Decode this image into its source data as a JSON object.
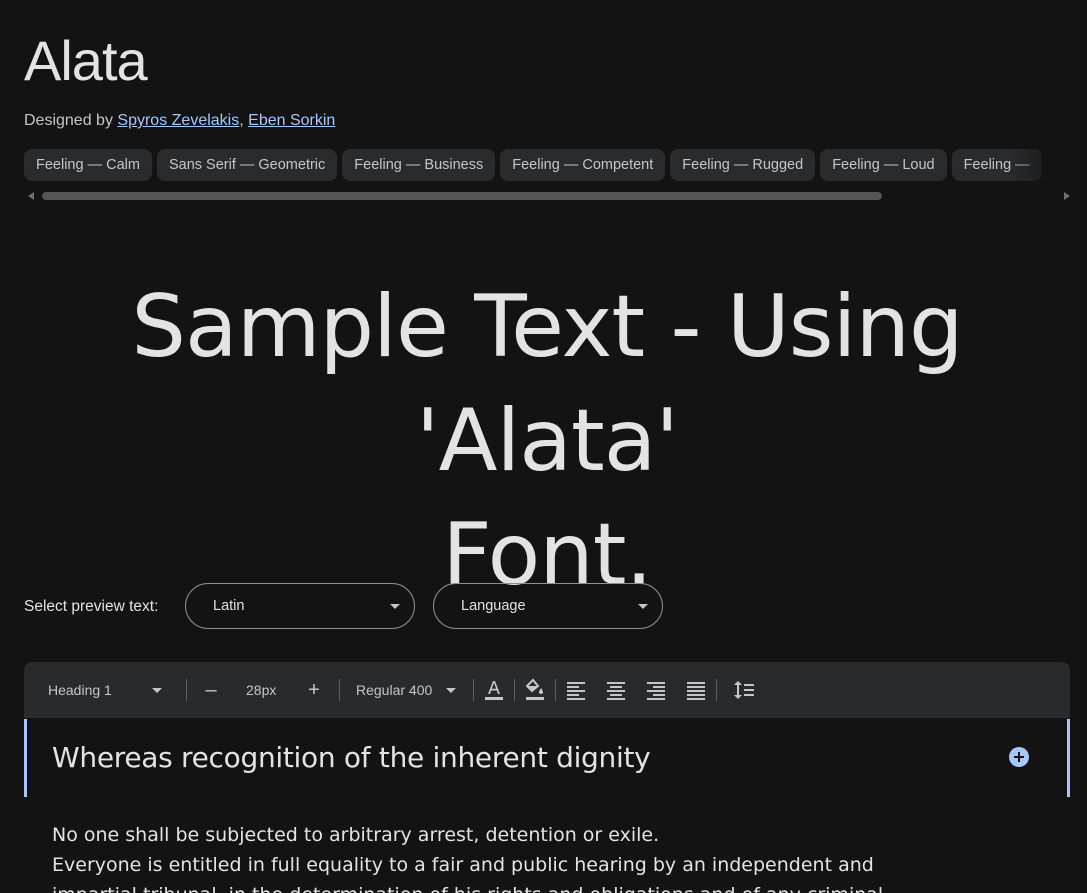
{
  "font": {
    "name": "Alata",
    "designed_by_label": "Designed by",
    "designers": [
      "Spyros Zevelakis",
      "Eben Sorkin"
    ],
    "designer_separator": ","
  },
  "tags": [
    "Feeling — Calm",
    "Sans Serif — Geometric",
    "Feeling — Business",
    "Feeling — Competent",
    "Feeling — Rugged",
    "Feeling — Loud",
    "Feeling —"
  ],
  "sample": {
    "line1": "Sample Text - Using 'Alata'",
    "line2": "Font."
  },
  "preview": {
    "label": "Select preview text:",
    "script_value": "Latin",
    "language_value": "Language"
  },
  "toolbar": {
    "style_value": "Heading 1",
    "decrease_label": "–",
    "size_value": "28px",
    "increase_label": "+",
    "weight_value": "Regular 400"
  },
  "editor": {
    "heading": "Whereas recognition of the inherent dignity",
    "body_lines": [
      "No one shall be subjected to arbitrary arrest, detention or exile.",
      "Everyone is entitled in full equality to a fair and public hearing by an independent and",
      "impartial tribunal, in the determination of his rights and obligations and of any criminal"
    ]
  },
  "colors": {
    "background": "#131314",
    "accent": "#a8c7fa",
    "chip": "#2a2b2d",
    "toolbar": "#282a2c"
  },
  "icons": [
    "text-color-icon",
    "highlight-color-icon",
    "align-left-icon",
    "align-center-icon",
    "align-right-icon",
    "align-justify-icon",
    "line-height-icon"
  ]
}
